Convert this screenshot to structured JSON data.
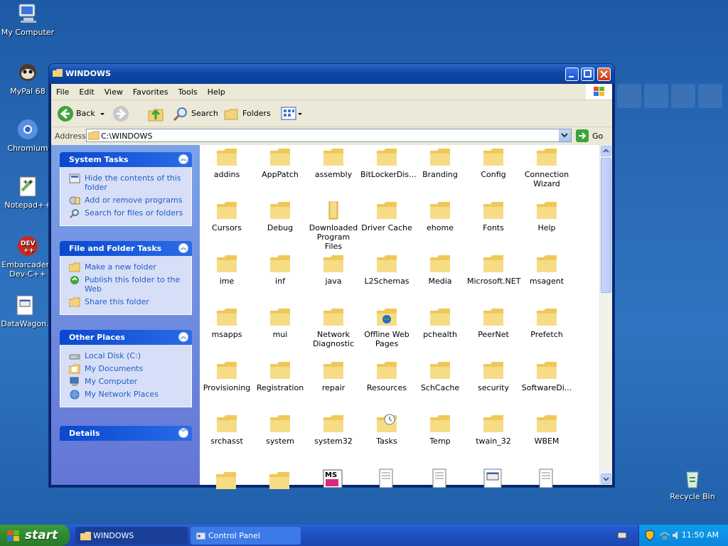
{
  "desktop": {
    "icons": [
      {
        "label": "My Computer"
      },
      {
        "label": "MyPal 68"
      },
      {
        "label": "Chromium"
      },
      {
        "label": "Notepad++"
      },
      {
        "label": "Embarcadero Dev-C++"
      },
      {
        "label": "DataWagon."
      },
      {
        "label": "Recycle Bin"
      }
    ]
  },
  "window": {
    "title": "WINDOWS",
    "menu": [
      "File",
      "Edit",
      "View",
      "Favorites",
      "Tools",
      "Help"
    ],
    "toolbar": {
      "back": "Back",
      "search": "Search",
      "folders": "Folders"
    },
    "address": {
      "label": "Address",
      "value": "C:\\WINDOWS",
      "go": "Go"
    }
  },
  "tasks": {
    "system": {
      "title": "System Tasks",
      "items": [
        "Hide the contents of this folder",
        "Add or remove programs",
        "Search for files or folders"
      ]
    },
    "file_folder": {
      "title": "File and Folder Tasks",
      "items": [
        "Make a new folder",
        "Publish this folder to the Web",
        "Share this folder"
      ]
    },
    "other": {
      "title": "Other Places",
      "items": [
        "Local Disk (C:)",
        "My Documents",
        "My Computer",
        "My Network Places"
      ]
    },
    "details": {
      "title": "Details"
    }
  },
  "files": [
    "addins",
    "AppPatch",
    "assembly",
    "BitLockerDis...",
    "Branding",
    "Config",
    "Connection Wizard",
    "Cursors",
    "Debug",
    "Downloaded Program Files",
    "Driver Cache",
    "ehome",
    "Fonts",
    "Help",
    "ime",
    "inf",
    "java",
    "L2Schemas",
    "Media",
    "Microsoft.NET",
    "msagent",
    "msapps",
    "mui",
    "Network Diagnostic",
    "Offline Web Pages",
    "pchealth",
    "PeerNet",
    "Prefetch",
    "Provisioning",
    "Registration",
    "repair",
    "Resources",
    "SchCache",
    "security",
    "SoftwareDi...",
    "srchasst",
    "system",
    "system32",
    "Tasks",
    "Temp",
    "twain_32",
    "WBEM"
  ],
  "taskbar": {
    "start": "start",
    "tasks": [
      "WINDOWS",
      "Control Panel"
    ],
    "clock": "11:50 AM"
  }
}
